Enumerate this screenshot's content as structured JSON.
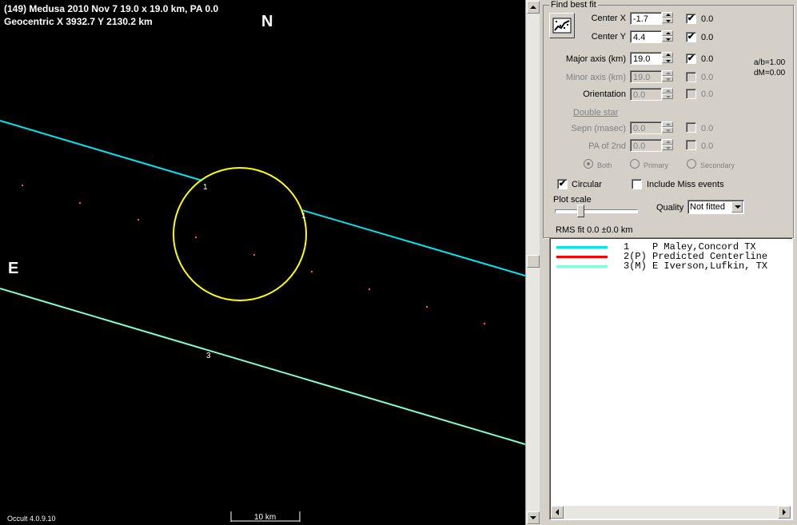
{
  "plot": {
    "title_line1": "(149) Medusa  2010 Nov 7  19.0 x 19.0 km, PA 0.0",
    "title_line2": "Geocentric  X  3932.7  Y 2130.2 km",
    "north": "N",
    "east": "E",
    "version": "Occult 4.0.9.10",
    "scale_label": "10 km",
    "chord_labels": [
      "1",
      "1",
      "3"
    ],
    "colors": {
      "background": "#000000",
      "chord1": "#00e5ee",
      "chord3": "#7fffd4",
      "ellipse": "#ffff00",
      "dots": "#ff5060"
    }
  },
  "panel": {
    "group_title": "Find best fit",
    "fit_button_icon": "chart-fit-icon",
    "center_x": {
      "label": "Center X",
      "value": "-1.7",
      "checked": "✔",
      "result": "0.0"
    },
    "center_y": {
      "label": "Center Y",
      "value": "4.4",
      "checked": "✔",
      "result": "0.0"
    },
    "major_axis": {
      "label": "Major axis (km)",
      "value": "19.0",
      "checked": "✔",
      "result": "0.0"
    },
    "minor_axis": {
      "label": "Minor axis (km)",
      "value": "19.0",
      "result": "0.0"
    },
    "orientation": {
      "label": "Orientation",
      "value": "0.0",
      "result": "0.0"
    },
    "ab_ratio": "a/b=1.00",
    "dm": "dM=0.00",
    "double_star": "Double star",
    "sepn": {
      "label": "Sepn (masec)",
      "value": "0.0",
      "result": "0.0"
    },
    "pa2nd": {
      "label": "PA of 2nd",
      "value": "0.0",
      "result": "0.0"
    },
    "radio_both": "Both",
    "radio_primary": "Primary",
    "radio_secondary": "Secondary",
    "circular": {
      "label": "Circular",
      "checked": "✔"
    },
    "include_miss": {
      "label": "Include Miss events"
    },
    "plot_scale": "Plot scale",
    "quality_label": "Quality",
    "quality_value": "Not fitted",
    "rms": "RMS fit 0.0 ±0.0 km",
    "observers": [
      {
        "num": "1",
        "text": "P Maley,Concord TX",
        "color": "#00e5ee"
      },
      {
        "num": "2(P)",
        "text": "Predicted Centerline",
        "color": "#ff0000"
      },
      {
        "num": "3(M)",
        "text": "E Iverson,Lufkin, TX",
        "color": "#7fffd4"
      }
    ]
  }
}
